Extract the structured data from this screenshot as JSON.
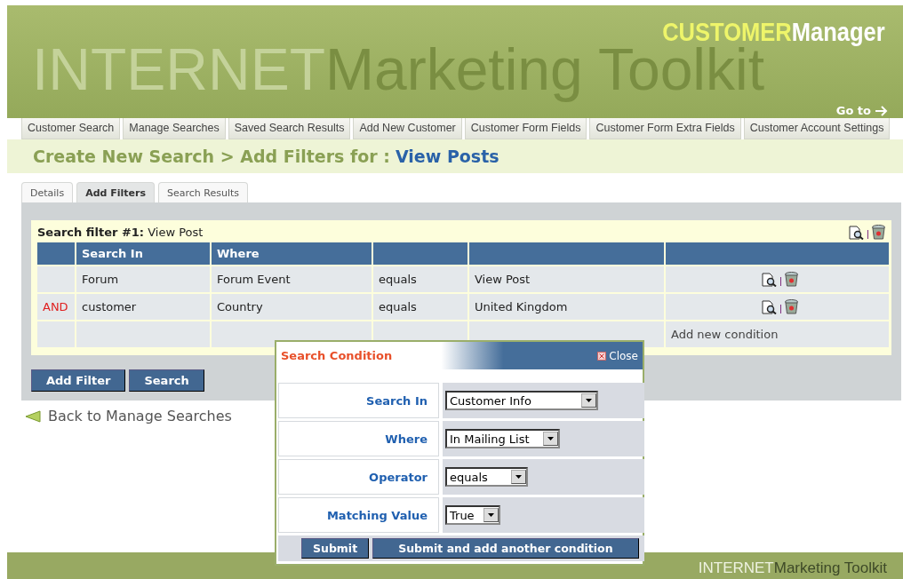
{
  "header": {
    "logo": {
      "first": "CUSTOMER",
      "second": "Manager"
    },
    "watermark": {
      "first": "INTERNET",
      "second": "Marketing Toolkit"
    },
    "goto": "Go to"
  },
  "nav": [
    "Customer Search",
    "Manage Searches",
    "Saved Search Results",
    "Add New Customer",
    "Customer Form Fields",
    "Customer Form Extra Fields",
    "Customer Account Settings"
  ],
  "breadcrumb": {
    "prefix": "Create New Search > Add Filters for :",
    "target": "View Posts"
  },
  "tabs": [
    {
      "label": "Details",
      "selected": false
    },
    {
      "label": "Add Filters",
      "selected": true
    },
    {
      "label": "Search Results",
      "selected": false
    }
  ],
  "filter": {
    "title_bold": "Search filter #1:",
    "title": "View Post",
    "columns": [
      "Search In",
      "Where"
    ],
    "rows": [
      {
        "search_in": "Forum",
        "where": "Forum Event",
        "operator": "equals",
        "value": "View Post"
      },
      {
        "join": "AND",
        "search_in": "customer",
        "where": "Country",
        "operator": "equals",
        "value": "United Kingdom"
      }
    ],
    "add_link": "Add new condition"
  },
  "buttons": [
    "Add Filter",
    "Search"
  ],
  "back_link": "Back to Manage Searches",
  "dialog": {
    "title": "Search Condition",
    "close": "Close",
    "fields": [
      {
        "label": "Search In",
        "value": "Customer Info"
      },
      {
        "label": "Where",
        "value": "In Mailing List"
      },
      {
        "label": "Operator",
        "value": "equals"
      },
      {
        "label": "Matching Value",
        "value": "True"
      }
    ],
    "buttons": [
      "Submit",
      "Submit and add another condition"
    ]
  },
  "footer": {
    "first": "INTERNET",
    "second": "Marketing Toolkit"
  }
}
